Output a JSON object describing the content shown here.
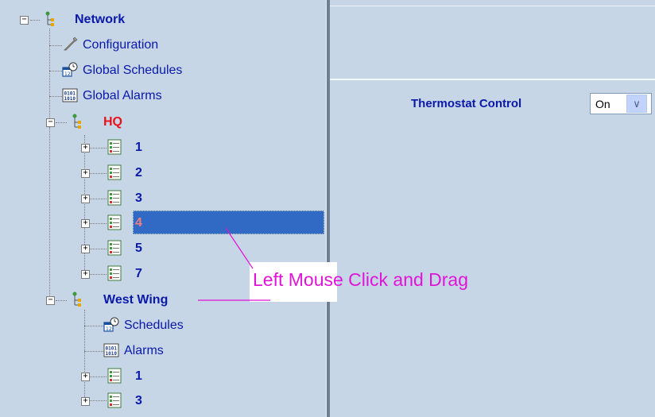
{
  "tree": {
    "root": {
      "label": "Network",
      "expander": "−"
    },
    "items": [
      {
        "label": "Configuration",
        "icon": "wrench-icon"
      },
      {
        "label": "Global Schedules",
        "icon": "calendar-clock-icon"
      },
      {
        "label": "Global Alarms",
        "icon": "alarm-grid-icon"
      }
    ],
    "hq": {
      "label": "HQ",
      "expander": "−"
    },
    "hq_children": [
      "1",
      "2",
      "3",
      "4",
      "5",
      "7"
    ],
    "selected_child": "4",
    "west_wing": {
      "label": "West Wing",
      "expander": "−"
    },
    "west_items": [
      {
        "label": "Schedules",
        "icon": "calendar-clock-icon"
      },
      {
        "label": "Alarms",
        "icon": "alarm-grid-icon"
      }
    ],
    "west_children": [
      "1",
      "3"
    ],
    "child_expander": "+"
  },
  "panel": {
    "thermostat_label": "Thermostat Control",
    "thermostat_value": "On",
    "dropdown_arrow": "∨"
  },
  "callout": {
    "text": "Left Mouse Click and Drag",
    "color": "#e014d8"
  },
  "colors": {
    "background": "#c6d6e6",
    "text_blue": "#0a19a8",
    "hq_red": "#e8121a",
    "selection": "#316ac5"
  }
}
